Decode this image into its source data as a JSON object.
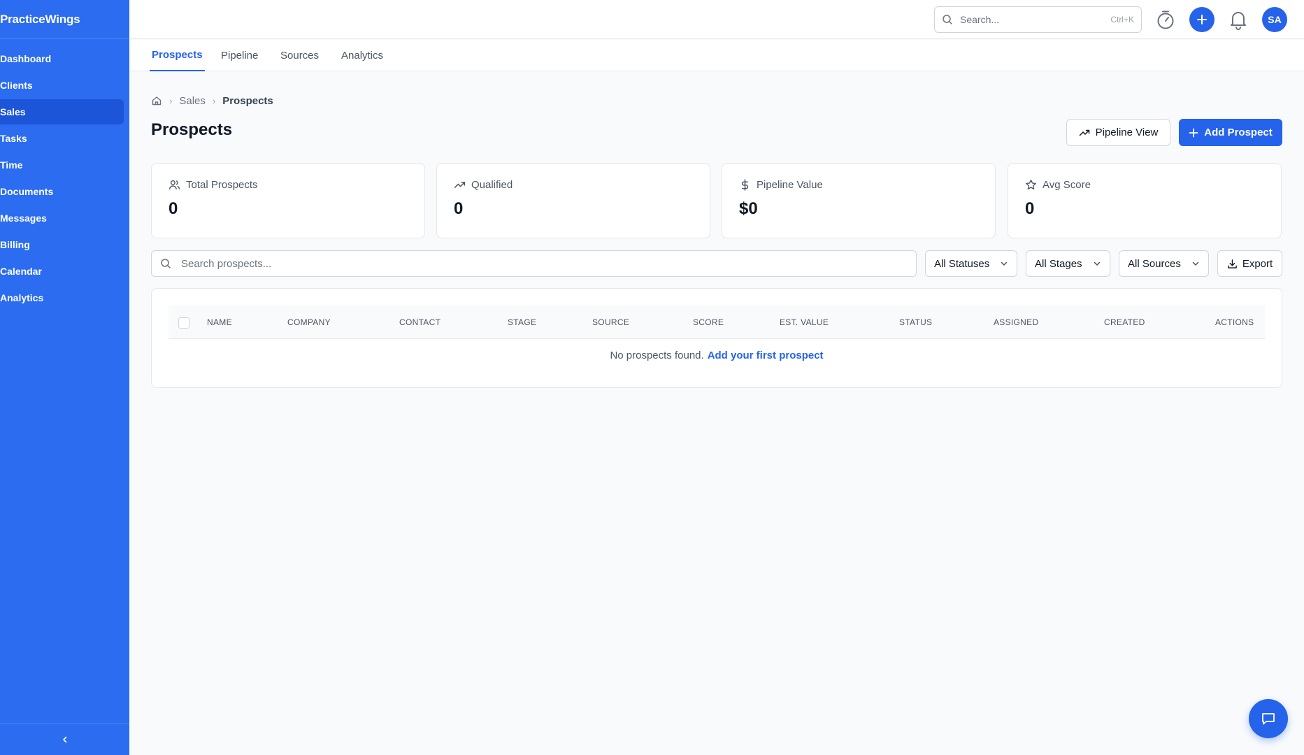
{
  "app": {
    "brand": "PracticeWings"
  },
  "sidebar": {
    "items": [
      {
        "label": "Dashboard"
      },
      {
        "label": "Clients"
      },
      {
        "label": "Sales",
        "active": true
      },
      {
        "label": "Tasks"
      },
      {
        "label": "Time"
      },
      {
        "label": "Documents"
      },
      {
        "label": "Messages"
      },
      {
        "label": "Billing"
      },
      {
        "label": "Calendar"
      },
      {
        "label": "Analytics"
      }
    ]
  },
  "topbar": {
    "search_placeholder": "Search...",
    "search_shortcut": "Ctrl+K",
    "avatar_initials": "SA"
  },
  "tabs": [
    {
      "label": "Prospects",
      "active": true
    },
    {
      "label": "Pipeline"
    },
    {
      "label": "Sources"
    },
    {
      "label": "Analytics"
    }
  ],
  "breadcrumb": {
    "section": "Sales",
    "current": "Prospects"
  },
  "page": {
    "title": "Prospects",
    "pipeline_view_label": "Pipeline View",
    "add_prospect_label": "Add Prospect"
  },
  "stats": [
    {
      "label": "Total Prospects",
      "value": "0",
      "icon": "users-icon"
    },
    {
      "label": "Qualified",
      "value": "0",
      "icon": "trending-up-icon"
    },
    {
      "label": "Pipeline Value",
      "value": "$0",
      "icon": "dollar-icon"
    },
    {
      "label": "Avg Score",
      "value": "0",
      "icon": "star-icon"
    }
  ],
  "filters": {
    "search_placeholder": "Search prospects...",
    "status": "All Statuses",
    "stage": "All Stages",
    "source": "All Sources",
    "export_label": "Export"
  },
  "table": {
    "columns": [
      "NAME",
      "COMPANY",
      "CONTACT",
      "STAGE",
      "SOURCE",
      "SCORE",
      "EST. VALUE",
      "STATUS",
      "ASSIGNED",
      "CREATED",
      "ACTIONS"
    ],
    "empty_text": "No prospects found.",
    "empty_link": "Add your first prospect"
  },
  "colors": {
    "sidebar": "#2b6cf0",
    "accent": "#2563eb",
    "background": "#f8fafc"
  }
}
